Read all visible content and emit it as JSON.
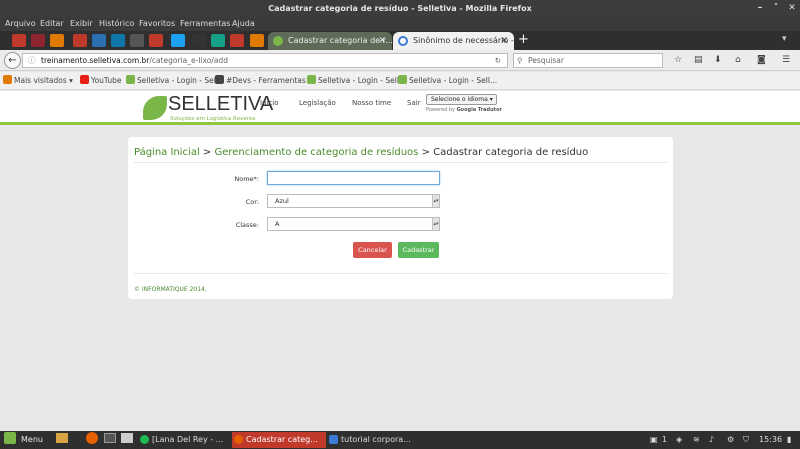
{
  "window": {
    "title": "Cadastrar categoria de resíduo - Selletiva - Mozilla Firefox"
  },
  "menu": [
    "Arquivo",
    "Editar",
    "Exibir",
    "Histórico",
    "Favoritos",
    "Ferramentas",
    "Ajuda"
  ],
  "tabs": [
    {
      "label": "Cadastrar categoria de r...",
      "active": true
    },
    {
      "label": "Sinônimo de necessário -",
      "active": false
    }
  ],
  "navbar": {
    "url_host": "treinamento.selletiva.com.br",
    "url_path": "/categoria_e-lixo/add",
    "search_placeholder": "Pesquisar"
  },
  "bookmarks": [
    {
      "label": "Mais visitados",
      "color": "#e07b00"
    },
    {
      "label": "YouTube",
      "color": "#e62117"
    },
    {
      "label": "Selletiva - Login - Sel...",
      "color": "#7ab648"
    },
    {
      "label": "#Devs - Ferramentas ...",
      "color": "#444444"
    },
    {
      "label": "Selletiva - Login - Sell...",
      "color": "#7ab648"
    },
    {
      "label": "Selletiva - Login - Sell...",
      "color": "#7ab648"
    }
  ],
  "site": {
    "brand": "SELLETIVA",
    "tagline": "Soluções em Logística Reversa",
    "nav": [
      "Início",
      "Legislação",
      "Nosso time",
      "Sair"
    ],
    "language_select": "Selecione o idioma",
    "powered_prefix": "Powered by",
    "powered_google": "Google",
    "powered_suffix": "Tradutor"
  },
  "breadcrumb": {
    "home": "Página Inicial",
    "sep1": " > ",
    "parent": "Gerenciamento de categoria de resíduos",
    "sep2": " > ",
    "current": "Cadastrar categoria de resíduo"
  },
  "form": {
    "name_label": "Nome*:",
    "name_value": "",
    "color_label": "Cor:",
    "color_value": "Azul",
    "class_label": "Classe:",
    "class_value": "A",
    "cancel_label": "Cancelar",
    "save_label": "Cadastrar"
  },
  "footer": "© INFORMATIQUE 2014.",
  "taskbar": {
    "menu_label": "Menu",
    "windows": [
      {
        "label": "[Lana Del Rey - ...",
        "active": false
      },
      {
        "label": "Cadastrar categ...",
        "active": true
      },
      {
        "label": "tutorial corpora...",
        "active": false
      }
    ],
    "notif_count": "1",
    "clock": "15:36"
  },
  "accent": "#8dc63f"
}
